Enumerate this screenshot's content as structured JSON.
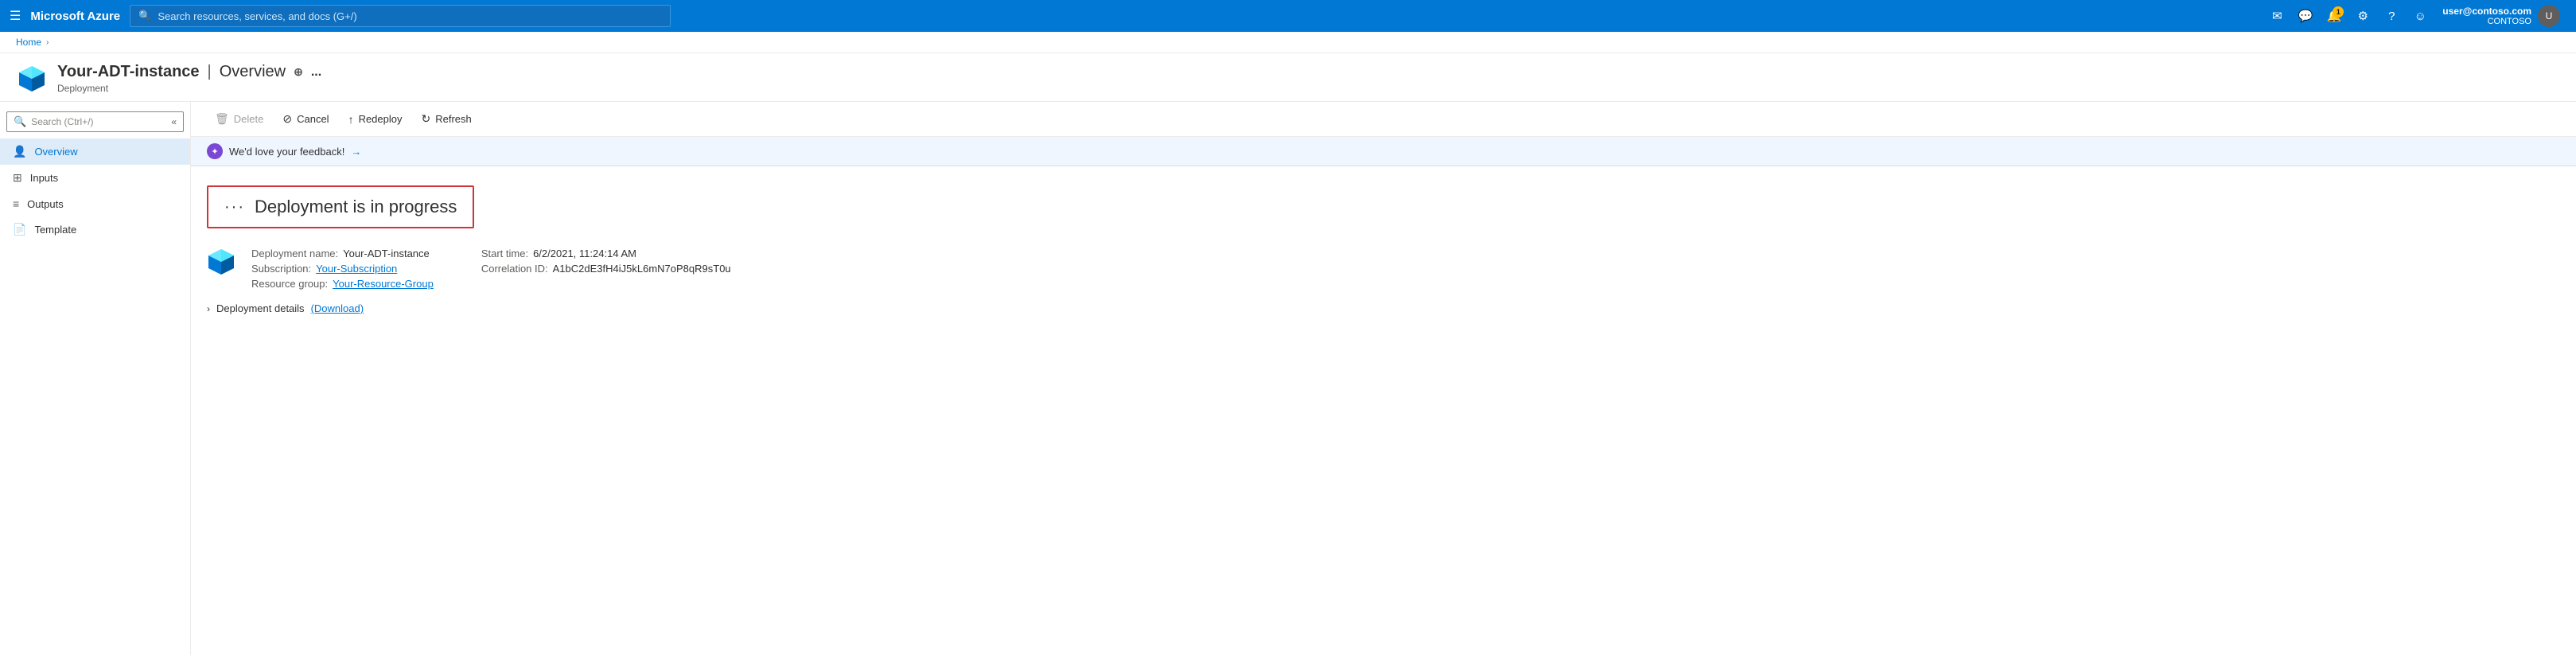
{
  "topnav": {
    "hamburger": "☰",
    "brand": "Microsoft Azure",
    "search_placeholder": "Search resources, services, and docs (G+/)",
    "user_name": "user@contoso.com",
    "user_tenant": "CONTOSO",
    "notification_count": "1",
    "icons": {
      "email": "✉",
      "chat": "💬",
      "bell": "🔔",
      "settings": "⚙",
      "help": "?",
      "feedback": "☺"
    }
  },
  "breadcrumb": {
    "home": "Home",
    "chevron": "›"
  },
  "page_header": {
    "title": "Your-ADT-instance",
    "separator": "|",
    "section": "Overview",
    "subtitle": "Deployment",
    "pin_icon": "⊕",
    "more_icon": "..."
  },
  "sidebar": {
    "search_placeholder": "Search (Ctrl+/)",
    "collapse_icon": "«",
    "items": [
      {
        "id": "overview",
        "label": "Overview",
        "icon": "👤",
        "active": true
      },
      {
        "id": "inputs",
        "label": "Inputs",
        "icon": "⊞"
      },
      {
        "id": "outputs",
        "label": "Outputs",
        "icon": "≡"
      },
      {
        "id": "template",
        "label": "Template",
        "icon": "📄"
      }
    ]
  },
  "toolbar": {
    "delete_label": "Delete",
    "cancel_label": "Cancel",
    "redeploy_label": "Redeploy",
    "refresh_label": "Refresh",
    "delete_icon": "🗑",
    "cancel_icon": "⊘",
    "redeploy_icon": "↑",
    "refresh_icon": "↻"
  },
  "feedback_bar": {
    "text": "We'd love your feedback!",
    "arrow": "→",
    "icon": "✦"
  },
  "deployment": {
    "status_text": "Deployment is in progress",
    "dots_icon": "···",
    "name_label": "Deployment name:",
    "name_value": "Your-ADT-instance",
    "subscription_label": "Subscription:",
    "subscription_value": "Your-Subscription",
    "resource_group_label": "Resource group:",
    "resource_group_value": "Your-Resource-Group",
    "start_time_label": "Start time:",
    "start_time_value": "6/2/2021, 11:24:14 AM",
    "correlation_label": "Correlation ID:",
    "correlation_value": "A1bC2dE3fH4iJ5kL6mN7oP8qR9sT0u",
    "details_label": "Deployment details",
    "download_label": "(Download)",
    "chevron": "›"
  }
}
